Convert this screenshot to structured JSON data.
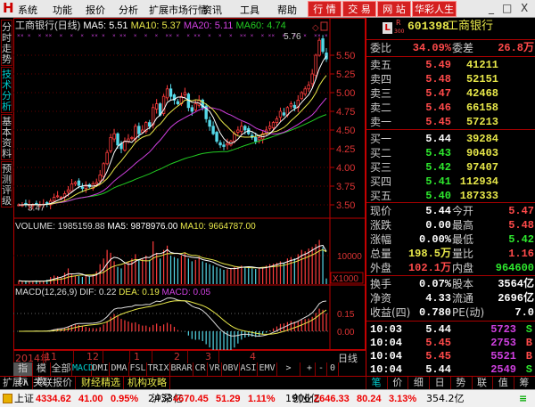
{
  "menubar": {
    "items": [
      "系统",
      "功能",
      "报价",
      "分析",
      "扩展市场行情",
      "资讯",
      "工具",
      "帮助"
    ],
    "buttons": [
      "行 情",
      "交 易",
      "网 站",
      "华彩人生"
    ],
    "controls": [
      "_",
      "□",
      "X"
    ]
  },
  "left_tabs": [
    "分时走势",
    "技术分析",
    "基本资料",
    "预测评级"
  ],
  "chart": {
    "title": "工商银行(日线)",
    "ma5": "MA5: 5.51",
    "ma10": "MA10: 5.37",
    "ma20": "MA20: 5.11",
    "ma60": "MA60: 4.74",
    "high_label": "5.76",
    "low_label": "3.47",
    "price_ticks": [
      "5.50",
      "5.25",
      "5.00",
      "4.75",
      "4.50",
      "4.25",
      "4.00",
      "3.75",
      "3.50"
    ],
    "colors": {
      "up": "#ff3c3c",
      "down": "#54d8e8",
      "ma5": "#ffffff",
      "ma10": "#e8e84a",
      "ma20": "#d040e0",
      "ma60": "#22cc22"
    },
    "closes": [
      3.5,
      3.5,
      3.51,
      3.5,
      3.5,
      3.51,
      3.5,
      3.51,
      3.52,
      3.55,
      3.6,
      3.62,
      3.6,
      3.65,
      3.7,
      3.78,
      3.8,
      3.76,
      3.72,
      3.75,
      3.74,
      3.78,
      3.8,
      3.9,
      4.05,
      4.2,
      4.4,
      4.45,
      4.3,
      4.25,
      4.35,
      4.38,
      4.4,
      4.55,
      4.45,
      4.5,
      4.6,
      4.55,
      4.8,
      4.85,
      4.7,
      4.95,
      5.05,
      4.95,
      4.9,
      4.85,
      4.95,
      5.0,
      4.8,
      4.75,
      4.85,
      4.9,
      4.8,
      4.65,
      4.55,
      4.45,
      4.35,
      4.3,
      4.28,
      4.32,
      4.35,
      4.45,
      4.5,
      4.55,
      4.5,
      4.45,
      4.4,
      4.35,
      4.4,
      4.45,
      4.5,
      4.55,
      4.6,
      4.65,
      4.75,
      4.7,
      4.8,
      4.85,
      4.8,
      4.9,
      5.0,
      5.05,
      5.1,
      5.25,
      5.5,
      5.7,
      5.55,
      5.45
    ],
    "volumes": [
      1200,
      900,
      1000,
      800,
      1100,
      1300,
      900,
      1000,
      1500,
      2500,
      3000,
      2800,
      2200,
      4000,
      5500,
      3500,
      3000,
      2800,
      2500,
      3000,
      2600,
      3500,
      4500,
      7000,
      9000,
      12000,
      11000,
      8000,
      6000,
      5500,
      7000,
      8000,
      9000,
      10500,
      8500,
      9000,
      10000,
      8500,
      15000,
      11000,
      9000,
      12000,
      13500,
      10000,
      9500,
      9000,
      10000,
      11000,
      9000,
      8000,
      8500,
      9500,
      8000,
      7500,
      7000,
      6500,
      6000,
      5500,
      5000,
      5200,
      5500,
      6000,
      6200,
      6500,
      6000,
      5800,
      5500,
      5300,
      5600,
      6000,
      6500,
      7000,
      7200,
      7500,
      8000,
      7500,
      9000,
      9500,
      9000,
      10500,
      12000,
      11500,
      12500,
      13000,
      14000,
      15500,
      13000,
      1985
    ]
  },
  "volume": {
    "label": "VOLUME: 1985159.88",
    "ma5": "MA5: 9878976.00",
    "ma10": "MA10: 9664787.00",
    "tick": "10000",
    "unit": "X1000"
  },
  "macd": {
    "label": "MACD(12,26,9)",
    "dif": "DIF: 0.22",
    "dea": "DEA: 0.19",
    "macd": "MACD: 0.05",
    "ticks": [
      "0.15",
      "0.00"
    ]
  },
  "dates": [
    "2014年",
    "11",
    "12",
    "1",
    "2",
    "3",
    "4"
  ],
  "period": "日线",
  "indicators": [
    "指标",
    "模板",
    "全部",
    "MACD",
    "DMI",
    "DMA",
    "FSL",
    "TRIX",
    "BRAR",
    "CR",
    "VR",
    "OBV",
    "ASI",
    "EMV",
    ">",
    "+",
    "-",
    "0"
  ],
  "ext_tabs": [
    "扩展∧",
    "关联报价",
    "财经精选",
    "机构攻略"
  ],
  "right_tabs": [
    "笔",
    "价",
    "细",
    "日",
    "势",
    "联",
    "值",
    "筹"
  ],
  "quote": {
    "badge_l": "L",
    "badge_r": "R",
    "badge_n": "300",
    "code": "601398",
    "name": "工商银行",
    "wb_label": "委比",
    "wb": "34.09%",
    "wc_label": "委差",
    "wc": "26.8万",
    "sell": [
      {
        "l": "卖五",
        "p": "5.49",
        "v": "41211"
      },
      {
        "l": "卖四",
        "p": "5.48",
        "v": "52151"
      },
      {
        "l": "卖三",
        "p": "5.47",
        "v": "42468"
      },
      {
        "l": "卖二",
        "p": "5.46",
        "v": "66158"
      },
      {
        "l": "卖一",
        "p": "5.45",
        "v": "57213"
      }
    ],
    "buy": [
      {
        "l": "买一",
        "p": "5.44",
        "v": "39284"
      },
      {
        "l": "买二",
        "p": "5.43",
        "v": "90403"
      },
      {
        "l": "买三",
        "p": "5.42",
        "v": "97407"
      },
      {
        "l": "买四",
        "p": "5.41",
        "v": "112934"
      },
      {
        "l": "买五",
        "p": "5.40",
        "v": "187333"
      }
    ],
    "stats": [
      {
        "l1": "现价",
        "v1": "5.44",
        "c1": "wht",
        "l2": "今开",
        "v2": "5.47",
        "c2": "red"
      },
      {
        "l1": "涨跌",
        "v1": "0.00",
        "c1": "wht",
        "l2": "最高",
        "v2": "5.48",
        "c2": "red"
      },
      {
        "l1": "涨幅",
        "v1": "0.00%",
        "c1": "wht",
        "l2": "最低",
        "v2": "5.42",
        "c2": "grn"
      },
      {
        "l1": "总量",
        "v1": "198.5万",
        "c1": "yel",
        "l2": "量比",
        "v2": "1.16",
        "c2": "red"
      },
      {
        "l1": "外盘",
        "v1": "102.1万",
        "c1": "red",
        "l2": "内盘",
        "v2": "964600",
        "c2": "grn"
      }
    ],
    "fund": [
      {
        "l1": "换手",
        "v1": "0.07%",
        "l2": "股本",
        "v2": "3564亿"
      },
      {
        "l1": "净资",
        "v1": "4.33",
        "l2": "流通",
        "v2": "2696亿"
      },
      {
        "l1": "收益(四)",
        "v1": "0.780",
        "l2": "PE(动)",
        "v2": "7.0"
      }
    ],
    "ticks": [
      {
        "t": "10:03",
        "p": "5.44",
        "c": "wht",
        "v": "5723",
        "s": "S"
      },
      {
        "t": "10:04",
        "p": "5.45",
        "c": "red",
        "v": "2753",
        "s": "B"
      },
      {
        "t": "10:04",
        "p": "5.45",
        "c": "red",
        "v": "5521",
        "s": "B"
      },
      {
        "t": "10:04",
        "p": "5.44",
        "c": "wht",
        "v": "2549",
        "s": "S"
      }
    ]
  },
  "status": {
    "sh": {
      "name": "上证",
      "v": "4334.62",
      "chg": "41.00",
      "pct": "0.95%",
      "amt": "2433亿"
    },
    "hs": {
      "name": "沪深",
      "v": "4670.45",
      "chg": "51.29",
      "pct": "1.11%",
      "amt": "1906亿"
    },
    "cy": {
      "name": "创业",
      "v": "2646.33",
      "chg": "80.24",
      "pct": "3.13%",
      "amt": "354.2亿"
    }
  }
}
